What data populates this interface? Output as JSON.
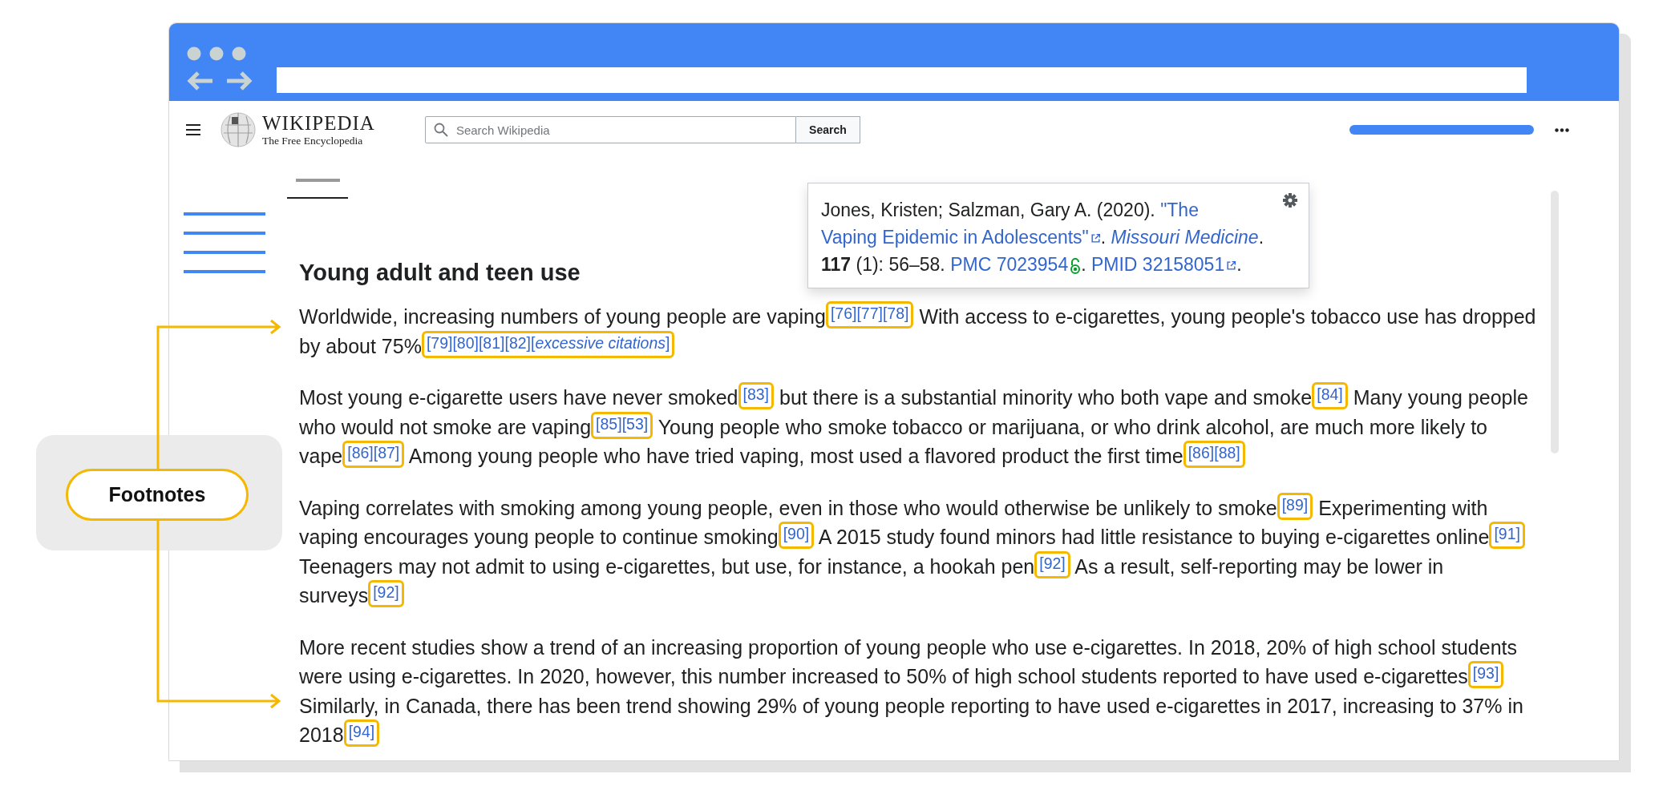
{
  "header": {
    "logo_title": "WIKIPEDIA",
    "logo_subtitle": "The Free Encyclopedia",
    "search": {
      "placeholder": "Search Wikipedia"
    },
    "search_button": "Search"
  },
  "popup": {
    "segments": [
      {
        "kind": "text",
        "text": "Jones, Kristen; Salzman, Gary A. (2020). "
      },
      {
        "kind": "plain_link",
        "text": "\"The"
      },
      {
        "kind": "external_link",
        "text": "Vaping Epidemic in Adolescents\""
      },
      {
        "kind": "text",
        "text": ". "
      },
      {
        "kind": "italic_link",
        "text": "Missouri Medicine"
      },
      {
        "kind": "text",
        "text": ". **117** (1): 56–58. "
      },
      {
        "kind": "open_access_link",
        "text": "PMC 7023954"
      },
      {
        "kind": "text",
        "text": ". "
      },
      {
        "kind": "external_link",
        "text": "PMID 32158051"
      },
      {
        "kind": "text",
        "text": "."
      }
    ]
  },
  "article": {
    "heading": "Young adult and teen use",
    "paragraphs": [
      [
        {
          "kind": "text",
          "text": "Worldwide, increasing numbers of young people are vaping"
        },
        {
          "kind": "ref",
          "text": "[76][77][78]"
        },
        {
          "kind": "text",
          "text": " With access to e-cigarettes, young people's tobacco use has dropped by about 75%"
        },
        {
          "kind": "ref",
          "text": "[79][80][81][82][*excessive citations*]"
        }
      ],
      [
        {
          "kind": "text",
          "text": "Most young e-cigarette users have never smoked"
        },
        {
          "kind": "ref",
          "text": "[83]"
        },
        {
          "kind": "text",
          "text": " but there is a substantial minority who both vape and smoke"
        },
        {
          "kind": "ref",
          "text": "[84]"
        },
        {
          "kind": "text",
          "text": " Many young people who would not smoke are vaping"
        },
        {
          "kind": "ref",
          "text": "[85][53]"
        },
        {
          "kind": "text",
          "text": " Young people who smoke tobacco or marijuana, or who drink alcohol, are much more likely to vape"
        },
        {
          "kind": "ref",
          "text": "[86][87]"
        },
        {
          "kind": "text",
          "text": " Among young people who have tried vaping, most used a flavored product the first time"
        },
        {
          "kind": "ref",
          "text": "[86][88]"
        }
      ],
      [
        {
          "kind": "text",
          "text": "Vaping correlates with smoking among young people, even in those who would otherwise be unlikely to smoke"
        },
        {
          "kind": "ref",
          "text": "[89]"
        },
        {
          "kind": "text",
          "text": " Experimenting with vaping encourages young people to continue smoking"
        },
        {
          "kind": "ref",
          "text": "[90]"
        },
        {
          "kind": "text",
          "text": " A 2015 study found minors had little resistance to buying e-cigarettes online"
        },
        {
          "kind": "ref",
          "text": "[91]"
        },
        {
          "kind": "text",
          "text": " Teenagers may not admit to using e-cigarettes, but use, for instance, a hookah pen"
        },
        {
          "kind": "ref",
          "text": "[92]"
        },
        {
          "kind": "text",
          "text": " As a result, self-reporting may be lower in surveys"
        },
        {
          "kind": "ref",
          "text": "[92]"
        }
      ],
      [
        {
          "kind": "text",
          "text": "More recent studies show a trend of an increasing proportion of young people who use e-cigarettes. In 2018, 20% of high school students were using e-cigarettes. In 2020, however, this number increased to 50% of high school students reported to have used e-cigarettes"
        },
        {
          "kind": "ref",
          "text": "[93]"
        },
        {
          "kind": "text",
          "text": " Similarly, in Canada, there has been trend showing 29% of young people reporting to have used e-cigarettes in 2017, increasing to 37% in 2018"
        },
        {
          "kind": "ref",
          "text": "[94]"
        }
      ]
    ]
  },
  "callout": {
    "label": "Footnotes"
  }
}
